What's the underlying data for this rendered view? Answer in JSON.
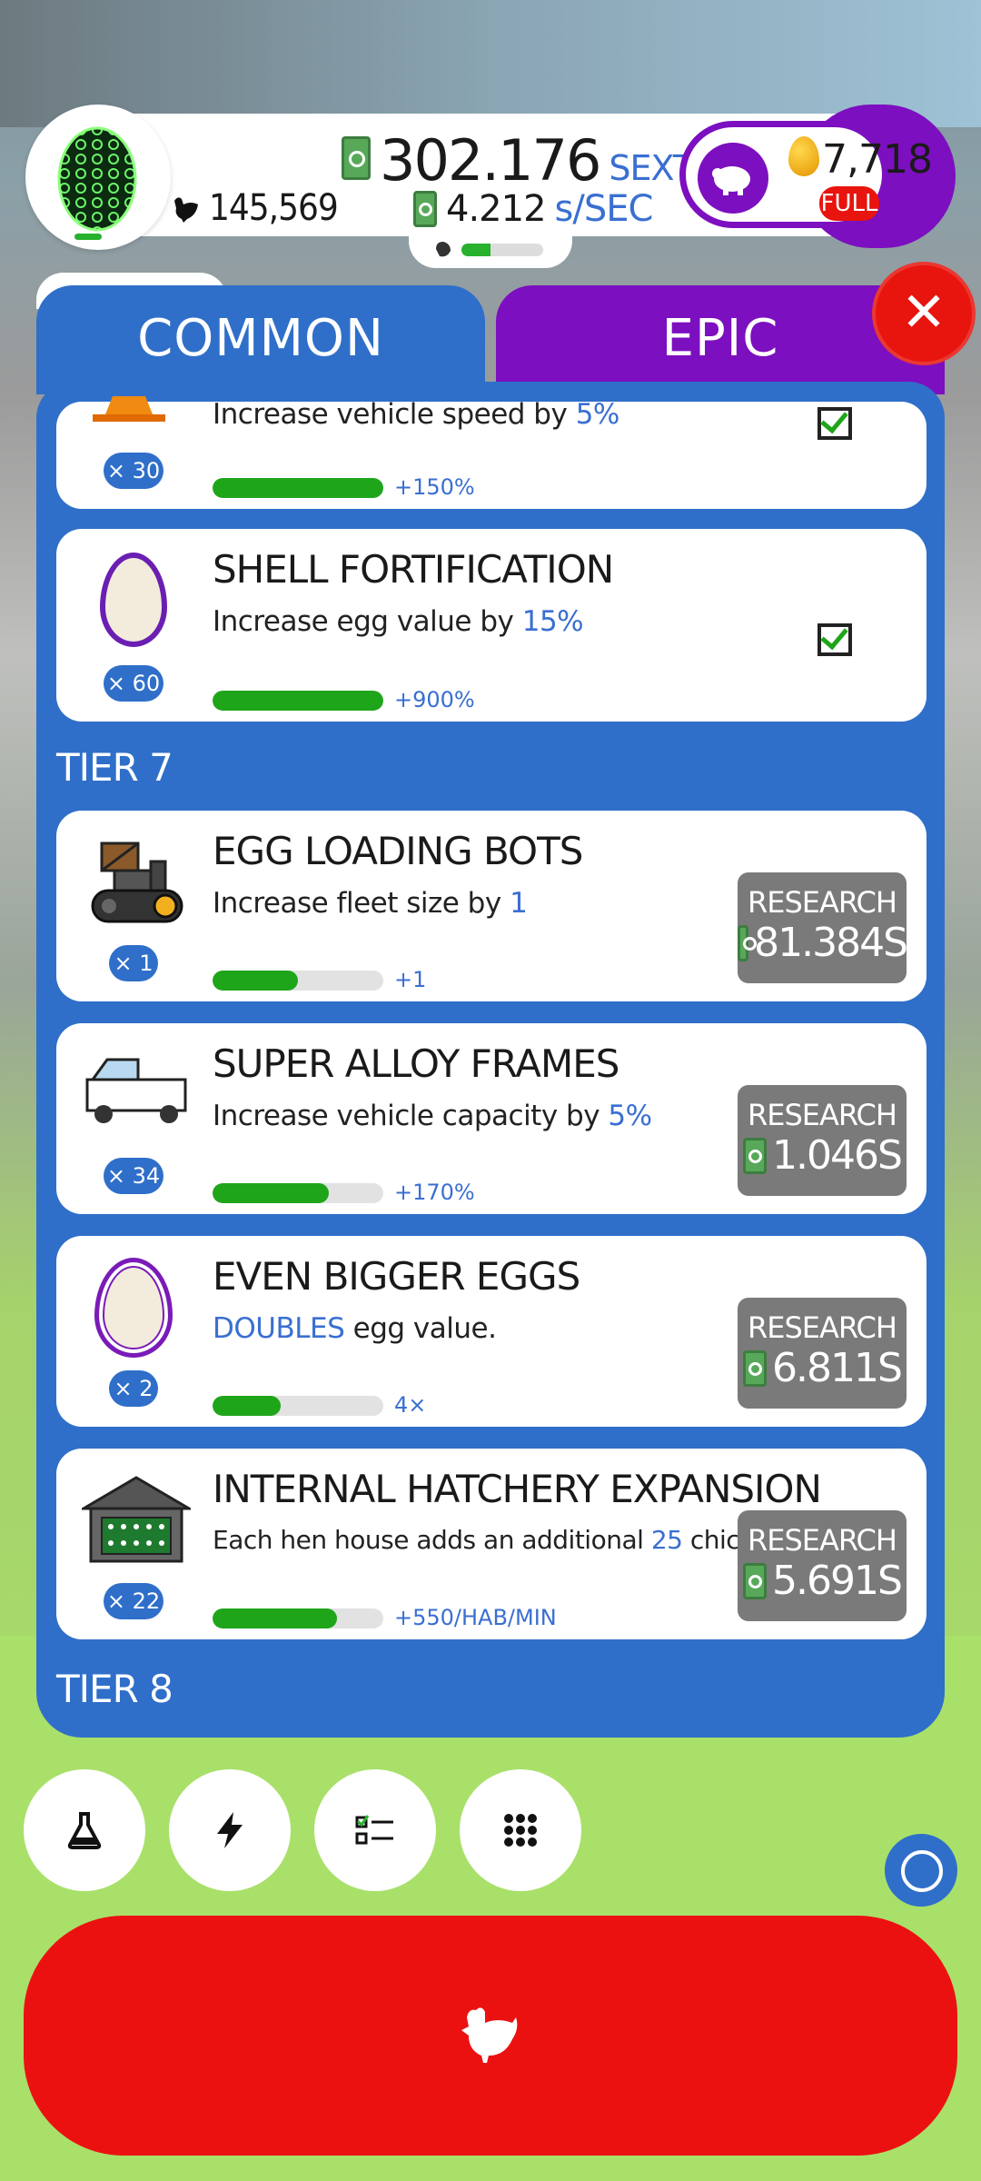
{
  "header": {
    "chicken_count": "145,569",
    "money_amount": "302.176",
    "money_unit": "SEXTILLION",
    "rate_amount": "4.212",
    "rate_unit": "s/SEC",
    "drone_progress": 0.35,
    "golden_eggs": "7,718",
    "piggy_status": "FULL"
  },
  "tabs": {
    "common": "COMMON",
    "epic": "EPIC",
    "close": "✕"
  },
  "research": {
    "button_label": "RESEARCH",
    "partial_card": {
      "desc_prefix": "Increase vehicle speed by ",
      "desc_value": "5%",
      "level": "× 30",
      "progress": 1.0,
      "bonus": "+150%"
    },
    "shell_card": {
      "title": "SHELL FORTIFICATION",
      "desc_prefix": "Increase egg value by ",
      "desc_value": "15%",
      "level": "× 60",
      "progress": 1.0,
      "bonus": "+900%"
    },
    "tier7": "TIER 7",
    "tier8": "TIER 8",
    "bots_card": {
      "title": "EGG LOADING BOTS",
      "desc_prefix": "Increase fleet size by ",
      "desc_value": "1",
      "level": "× 1",
      "progress": 0.5,
      "bonus": "+1",
      "price": "81.384S"
    },
    "frames_card": {
      "title": "SUPER ALLOY FRAMES",
      "desc_prefix": "Increase vehicle capacity by ",
      "desc_value": "5%",
      "level": "× 34",
      "progress": 0.68,
      "bonus": "+170%",
      "price": "1.046S"
    },
    "eggs_card": {
      "title": "EVEN BIGGER EGGS",
      "desc_highlight": "DOUBLES",
      "desc_suffix": " egg value.",
      "level": "× 2",
      "progress": 0.4,
      "bonus": "4×",
      "price": "6.811S"
    },
    "hatchery_card": {
      "title": "INTERNAL HATCHERY EXPANSION",
      "desc_prefix": "Each hen house adds an additional ",
      "desc_value": "25",
      "desc_suffix": " chickens/min",
      "level": "× 22",
      "progress": 0.73,
      "bonus": "+550/HAB/MIN",
      "price": "5.691S"
    }
  },
  "nav": {
    "icons": [
      "flask-icon",
      "lightning-icon",
      "checklist-icon",
      "grid-icon"
    ]
  },
  "colors": {
    "accent_blue": "#2f6fc9",
    "epic_purple": "#7c0fbf",
    "progress_green": "#1fa51a",
    "hatch_red": "#ec1111"
  }
}
